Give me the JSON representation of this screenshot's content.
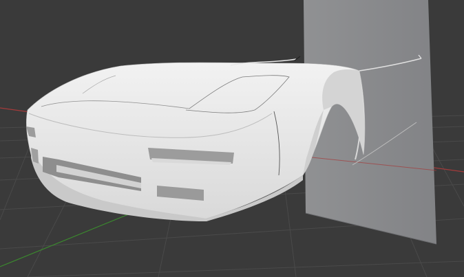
{
  "viewport": {
    "background": "#3a3a3a",
    "grid_color": "#4a4a4a",
    "x_axis_color": "#a53a3a",
    "y_axis_color": "#3b8a2e"
  },
  "scene": {
    "objects": [
      {
        "name": "car-front-body",
        "color": "#e3e3e3"
      },
      {
        "name": "reference-plane",
        "color": "#8c8d8f"
      }
    ]
  }
}
